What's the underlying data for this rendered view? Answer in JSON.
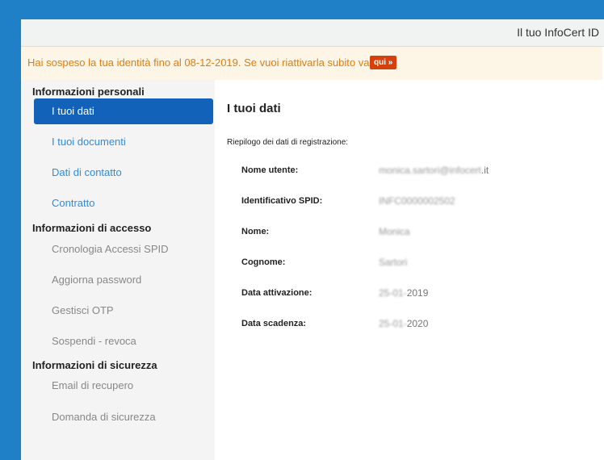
{
  "header": {
    "title": "Il tuo InfoCert ID"
  },
  "alert": {
    "message": "Hai sospeso la tua identità fino al 08-12-2019. Se vuoi riattivarla subito vai",
    "link_label": "qui »"
  },
  "sidebar": {
    "sections": [
      {
        "title": "Informazioni personali"
      },
      {
        "title": "Informazioni di accesso"
      },
      {
        "title": "Informazioni di sicurezza"
      }
    ],
    "items": [
      {
        "label": "I tuoi dati"
      },
      {
        "label": "I tuoi documenti"
      },
      {
        "label": "Dati di contatto"
      },
      {
        "label": "Contratto"
      },
      {
        "label": "Cronologia Accessi SPID"
      },
      {
        "label": "Aggiorna password"
      },
      {
        "label": "Gestisci OTP"
      },
      {
        "label": "Sospendi - revoca"
      },
      {
        "label": "Email di recupero"
      },
      {
        "label": "Domanda di sicurezza"
      }
    ]
  },
  "main": {
    "title": "I tuoi dati",
    "summary": "Riepilogo dei dati di registrazione:",
    "fields": [
      {
        "label": "Nome utente:",
        "value_blur": "monica.sartori@infocert",
        "value_tail": ".it"
      },
      {
        "label": "Identificativo SPID:",
        "value_blur": "INFC0000002502",
        "value_tail": ""
      },
      {
        "label": "Nome:",
        "value_blur": "Monica",
        "value_tail": ""
      },
      {
        "label": "Cognome:",
        "value_blur": "Sartori",
        "value_tail": ""
      },
      {
        "label": "Data attivazione:",
        "value_blur": "25-01-",
        "value_tail": "2019"
      },
      {
        "label": "Data scadenza:",
        "value_blur": "25-01-",
        "value_tail": "2020"
      }
    ]
  }
}
